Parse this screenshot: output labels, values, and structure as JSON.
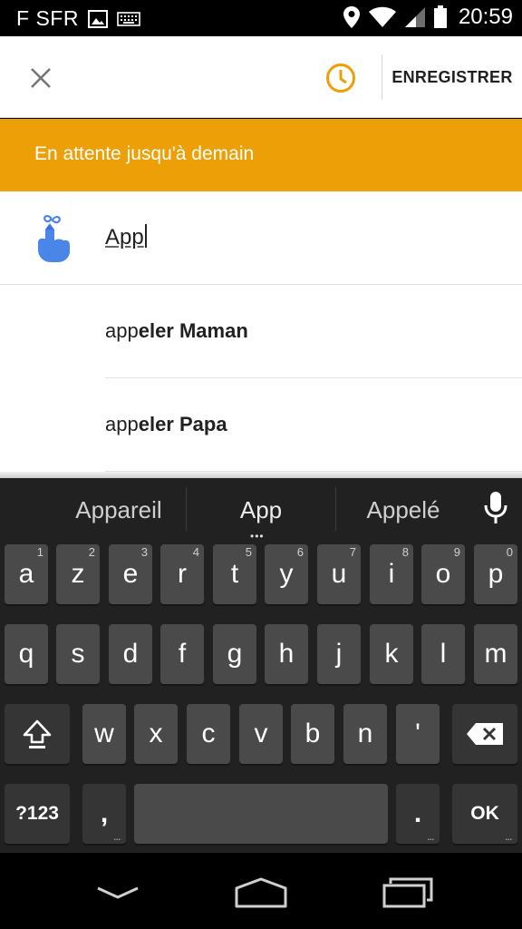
{
  "status_bar": {
    "carrier": "F SFR",
    "time": "20:59",
    "icons": [
      "image-icon",
      "keyboard-icon",
      "location-icon",
      "wifi-icon",
      "signal-icon",
      "battery-icon"
    ]
  },
  "app_bar": {
    "close_icon": "close-icon",
    "snooze_icon": "clock-icon",
    "save_label": "ENREGISTRER",
    "accent_color": "#ec9f06"
  },
  "banner": {
    "text": "En attente jusqu'à demain",
    "color": "#ec9f06"
  },
  "reminder": {
    "icon": "reminder-finger-icon",
    "input_value": "App"
  },
  "suggestions": [
    {
      "prefix": "app",
      "rest": "eler Maman"
    },
    {
      "prefix": "app",
      "rest": "eler Papa"
    }
  ],
  "keyboard": {
    "suggestions": [
      "Appareil",
      "App",
      "Appelé"
    ],
    "more_indicator": "•••",
    "mic_icon": "microphone-icon",
    "row1": [
      {
        "label": "a",
        "hint": "1"
      },
      {
        "label": "z",
        "hint": "2"
      },
      {
        "label": "e",
        "hint": "3"
      },
      {
        "label": "r",
        "hint": "4"
      },
      {
        "label": "t",
        "hint": "5"
      },
      {
        "label": "y",
        "hint": "6"
      },
      {
        "label": "u",
        "hint": "7"
      },
      {
        "label": "i",
        "hint": "8"
      },
      {
        "label": "o",
        "hint": "9"
      },
      {
        "label": "p",
        "hint": "0"
      }
    ],
    "row2": [
      "q",
      "s",
      "d",
      "f",
      "g",
      "h",
      "j",
      "k",
      "l",
      "m"
    ],
    "row3": [
      "w",
      "x",
      "c",
      "v",
      "b",
      "n",
      "'"
    ],
    "shift_icon": "shift-icon",
    "backspace_icon": "backspace-icon",
    "symbols_label": "?123",
    "comma_label": ",",
    "period_label": ".",
    "ok_label": "OK",
    "dots_label": "..."
  },
  "nav_bar": {
    "back_icon": "chevron-down-icon",
    "home_icon": "home-icon",
    "recents_icon": "recents-icon"
  }
}
